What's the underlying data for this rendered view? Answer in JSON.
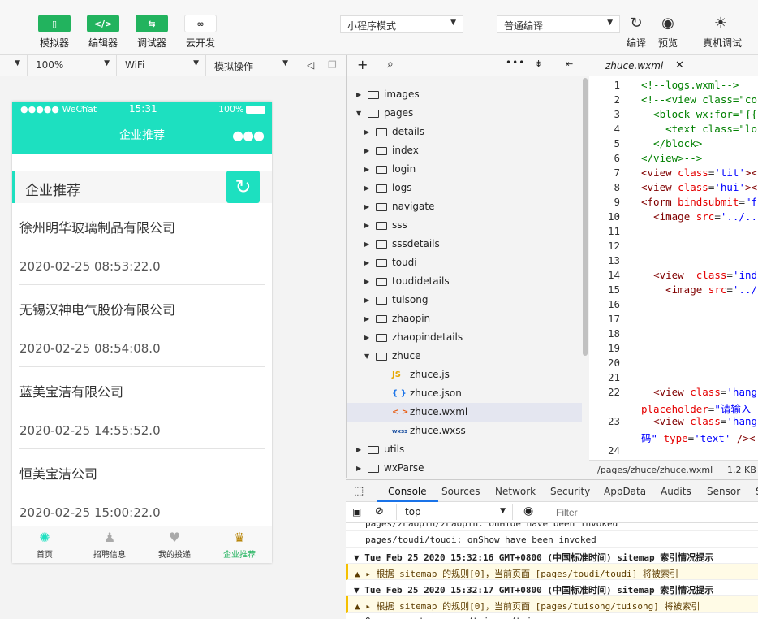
{
  "toolbar": {
    "buttons": [
      {
        "label": "模拟器",
        "icon": "phone-icon"
      },
      {
        "label": "编辑器",
        "icon": "code-icon"
      },
      {
        "label": "调试器",
        "icon": "debug-arrows-icon"
      },
      {
        "label": "云开发",
        "icon": "cloud-link-icon"
      }
    ],
    "mode": "小程序模式",
    "compile": "普通编译",
    "right": [
      {
        "label": "编译",
        "icon": "refresh-icon"
      },
      {
        "label": "预览",
        "icon": "eye-icon"
      },
      {
        "label": "真机调试",
        "icon": "bug-icon"
      }
    ]
  },
  "simbar": {
    "device": "",
    "zoom": "100%",
    "network": "WiFi",
    "operation": "模拟操作"
  },
  "phone": {
    "carrier": "●●●●● WeChat",
    "time": "15:31",
    "battery": "100%",
    "nav_title": "企业推荐",
    "section_title": "企业推荐",
    "items": [
      {
        "name": "徐州明华玻璃制品有限公司",
        "time": "2020-02-25 08:53:22.0"
      },
      {
        "name": "无锡汉神电气股份有限公司",
        "time": "2020-02-25 08:54:08.0"
      },
      {
        "name": "蓝美宝洁有限公司",
        "time": "2020-02-25 14:55:52.0"
      },
      {
        "name": "恒美宝洁公司",
        "time": "2020-02-25 15:00:22.0"
      }
    ],
    "tabs": [
      {
        "label": "首页",
        "icon": "home-icon"
      },
      {
        "label": "招聘信息",
        "icon": "person-icon"
      },
      {
        "label": "我的投递",
        "icon": "heart-icon"
      },
      {
        "label": "企业推荐",
        "icon": "crown-icon"
      }
    ],
    "accent": "#1de0c0"
  },
  "tree": {
    "items": [
      {
        "name": "images",
        "type": "folder",
        "depth": 0,
        "open": false
      },
      {
        "name": "pages",
        "type": "folder",
        "depth": 0,
        "open": true
      },
      {
        "name": "details",
        "type": "folder",
        "depth": 1,
        "open": false
      },
      {
        "name": "index",
        "type": "folder",
        "depth": 1,
        "open": false
      },
      {
        "name": "login",
        "type": "folder",
        "depth": 1,
        "open": false
      },
      {
        "name": "logs",
        "type": "folder",
        "depth": 1,
        "open": false
      },
      {
        "name": "navigate",
        "type": "folder",
        "depth": 1,
        "open": false
      },
      {
        "name": "sss",
        "type": "folder",
        "depth": 1,
        "open": false
      },
      {
        "name": "sssdetails",
        "type": "folder",
        "depth": 1,
        "open": false
      },
      {
        "name": "toudi",
        "type": "folder",
        "depth": 1,
        "open": false
      },
      {
        "name": "toudidetails",
        "type": "folder",
        "depth": 1,
        "open": false
      },
      {
        "name": "tuisong",
        "type": "folder",
        "depth": 1,
        "open": false
      },
      {
        "name": "zhaopin",
        "type": "folder",
        "depth": 1,
        "open": false
      },
      {
        "name": "zhaopindetails",
        "type": "folder",
        "depth": 1,
        "open": false
      },
      {
        "name": "zhuce",
        "type": "folder",
        "depth": 1,
        "open": true
      },
      {
        "name": "zhuce.js",
        "type": "js",
        "depth": 2
      },
      {
        "name": "zhuce.json",
        "type": "json",
        "depth": 2
      },
      {
        "name": "zhuce.wxml",
        "type": "wxml",
        "depth": 2,
        "selected": true
      },
      {
        "name": "zhuce.wxss",
        "type": "wxss",
        "depth": 2
      },
      {
        "name": "utils",
        "type": "folder",
        "depth": 0,
        "open": false
      },
      {
        "name": "wxParse",
        "type": "folder",
        "depth": 0,
        "open": false
      }
    ]
  },
  "editor": {
    "tab": "zhuce.wxml",
    "path": "/pages/zhuce/zhuce.wxml",
    "size": "1.2 KB",
    "lines": [
      {
        "n": "1",
        "html": "<span class='cm'>&lt;!--logs.wxml--&gt;</span>"
      },
      {
        "n": "2",
        "html": "<span class='cm'>&lt;!--&lt;view class=\"co</span>"
      },
      {
        "n": "3",
        "html": "<span class='cm'>  &lt;block wx:for=\"{{</span>"
      },
      {
        "n": "4",
        "html": "<span class='cm'>    &lt;text class=\"lo</span>"
      },
      {
        "n": "5",
        "html": "<span class='cm'>  &lt;/block&gt;</span>"
      },
      {
        "n": "6",
        "html": "<span class='cm'>&lt;/view&gt;--&gt;</span>"
      },
      {
        "n": "7",
        "html": "<span class='tg'>&lt;view</span> <span class='at'>class</span>=<span class='st'>'tit'</span><span class='tg'>&gt;&lt;</span>"
      },
      {
        "n": "8",
        "html": "<span class='tg'>&lt;view</span> <span class='at'>class</span>=<span class='st'>'hui'</span><span class='tg'>&gt;&lt;</span>"
      },
      {
        "n": "9",
        "html": "<span class='tg'>&lt;form</span> <span class='at'>bindsubmit</span>=<span class='st'>\"f</span>"
      },
      {
        "n": "10",
        "html": "  <span class='tg'>&lt;image</span> <span class='at'>src</span>=<span class='st'>'../..</span>"
      },
      {
        "n": "11",
        "html": ""
      },
      {
        "n": "12",
        "html": ""
      },
      {
        "n": "13",
        "html": ""
      },
      {
        "n": "14",
        "html": "  <span class='tg'>&lt;view</span>  <span class='at'>class</span>=<span class='st'>'ind</span>"
      },
      {
        "n": "15",
        "html": "    <span class='tg'>&lt;image</span> <span class='at'>src</span>=<span class='st'>'../</span>"
      },
      {
        "n": "16",
        "html": ""
      },
      {
        "n": "17",
        "html": ""
      },
      {
        "n": "18",
        "html": ""
      },
      {
        "n": "19",
        "html": ""
      },
      {
        "n": "20",
        "html": ""
      },
      {
        "n": "21",
        "html": ""
      },
      {
        "n": "22",
        "html": "  <span class='tg'>&lt;view</span> <span class='at'>class</span>=<span class='st'>'hang</span>"
      },
      {
        "n": "",
        "html": "<span class='at'>placeholder</span>=<span class='st'>\"请输入</span>"
      },
      {
        "n": "23",
        "html": "  <span class='tg'>&lt;view</span> <span class='at'>class</span>=<span class='st'>'hang</span>"
      },
      {
        "n": "",
        "html": "<span class='st'>码\"</span> <span class='at'>type</span>=<span class='st'>'text'</span> <span class='tg'>/&gt;&lt;</span>"
      },
      {
        "n": "24",
        "html": ""
      }
    ]
  },
  "devtools": {
    "tabs": [
      "Console",
      "Sources",
      "Network",
      "Security",
      "AppData",
      "Audits",
      "Sensor",
      "S"
    ],
    "context": "top",
    "filter_placeholder": "Filter",
    "lines": [
      {
        "text": "pages/zhaopin/zhaopin: onHide have been invoked",
        "kind": "log"
      },
      {
        "text": "pages/toudi/toudi: onShow have been invoked",
        "kind": "log"
      },
      {
        "text": "▼ Tue Feb 25 2020 15:32:16 GMT+0800 (中国标准时间) sitemap 索引情况提示",
        "kind": "group"
      },
      {
        "text": "▲ ▸ 根据 sitemap 的规则[0]，当前页面 [pages/toudi/toudi] 将被索引",
        "kind": "warn"
      },
      {
        "text": "▼ Tue Feb 25 2020 15:32:17 GMT+0800 (中国标准时间) sitemap 索引情况提示",
        "kind": "group"
      },
      {
        "text": "▲ ▸ 根据 sitemap 的规则[0]，当前页面 [pages/tuisong/tuisong] 将被索引",
        "kind": "warn"
      },
      {
        "text": "On app route: pages/tuisong/tuisong",
        "kind": "log"
      }
    ]
  }
}
